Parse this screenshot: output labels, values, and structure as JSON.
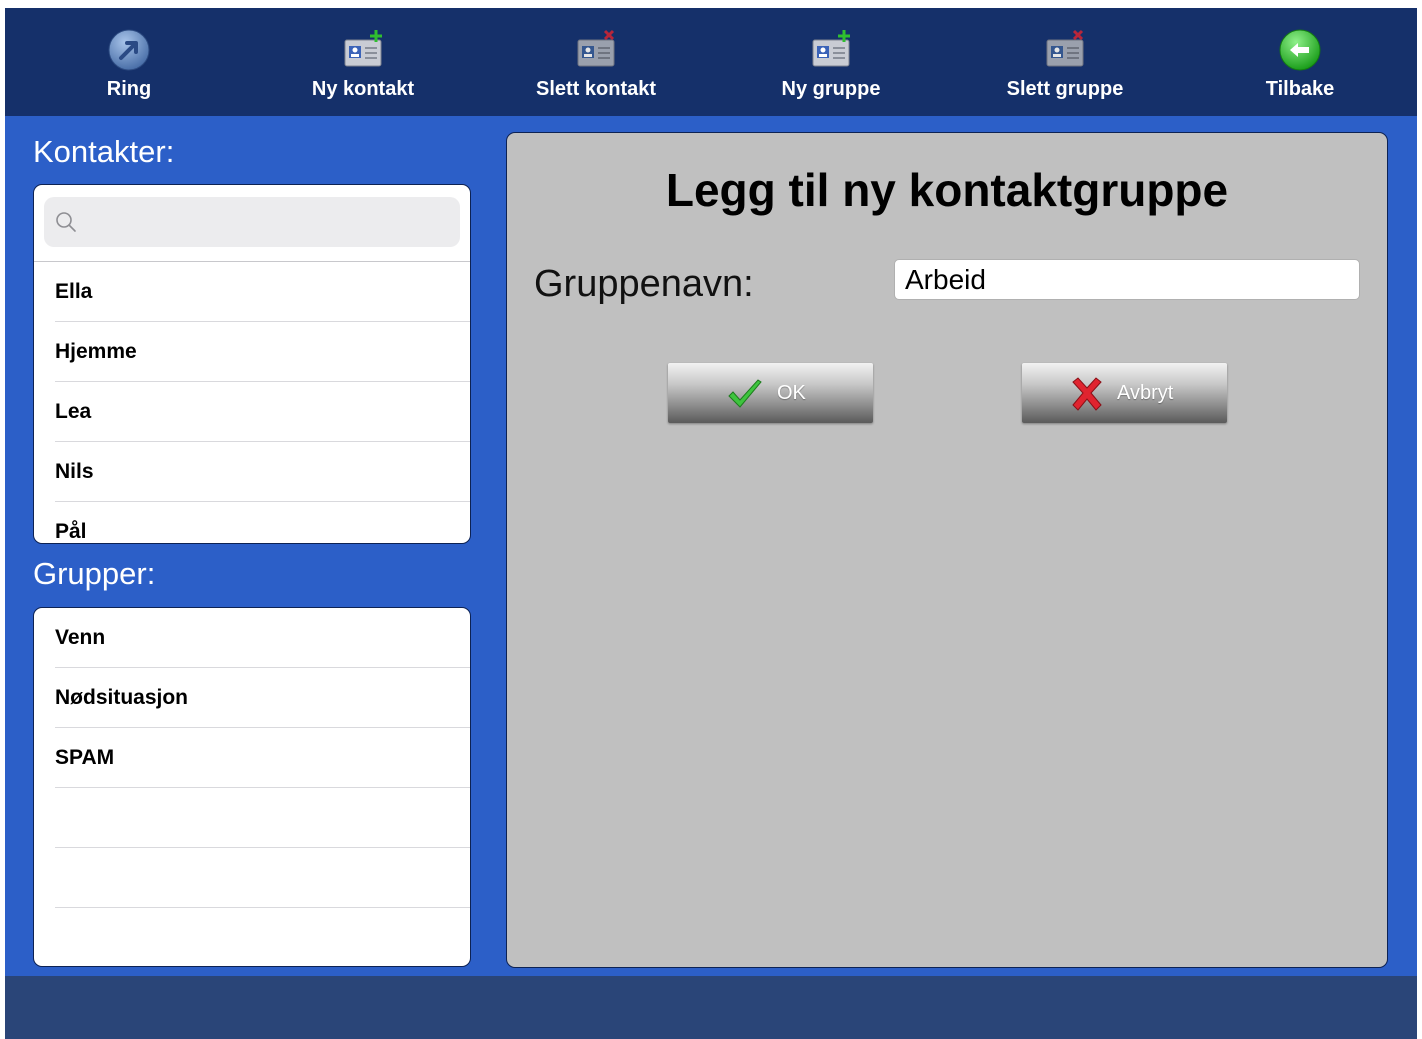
{
  "toolbar": {
    "items": [
      {
        "label": "Ring",
        "icon": "phone-arrow-icon"
      },
      {
        "label": "Ny kontakt",
        "icon": "contact-card-add-icon"
      },
      {
        "label": "Slett kontakt",
        "icon": "contact-card-delete-icon"
      },
      {
        "label": "Ny gruppe",
        "icon": "group-card-add-icon"
      },
      {
        "label": "Slett gruppe",
        "icon": "group-card-delete-icon"
      },
      {
        "label": "Tilbake",
        "icon": "back-arrow-icon"
      }
    ]
  },
  "contacts": {
    "heading": "Kontakter:",
    "search_placeholder": "",
    "items": [
      "Ella",
      "Hjemme",
      "Lea",
      "Nils",
      "Pål"
    ]
  },
  "groups": {
    "heading": "Grupper:",
    "items": [
      "Venn",
      "Nødsituasjon",
      "SPAM"
    ]
  },
  "dialog": {
    "title": "Legg til ny kontaktgruppe",
    "field_label": "Gruppenavn:",
    "field_value": "Arbeid",
    "ok_label": "OK",
    "cancel_label": "Avbryt"
  },
  "colors": {
    "toolbar_bg": "#15306a",
    "background": "#2c5fc8",
    "panel_bg": "#c0c0c0",
    "bottom_bar": "#2a4578"
  }
}
